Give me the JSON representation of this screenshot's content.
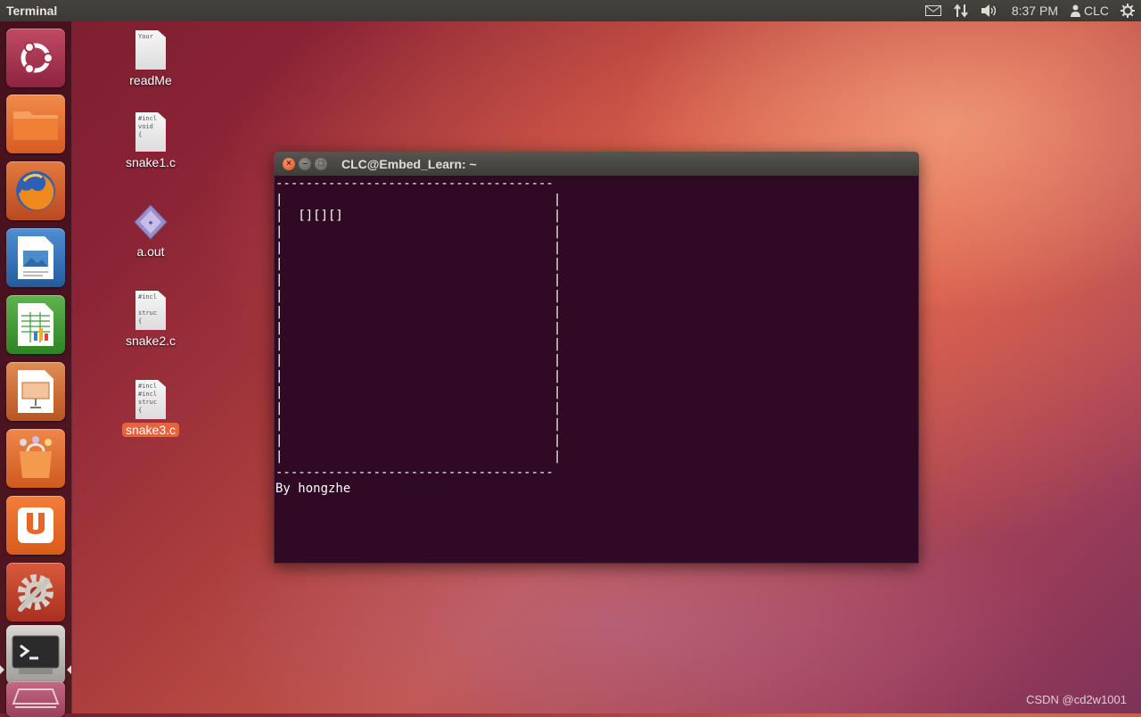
{
  "top_panel": {
    "app_title": "Terminal",
    "clock": "8:37 PM",
    "user": "CLC"
  },
  "launcher": {
    "items": [
      {
        "name": "dash-home",
        "icon": "ubuntu-logo-icon",
        "color": "#b0334d"
      },
      {
        "name": "files",
        "icon": "folder-icon",
        "color": "#e96d31"
      },
      {
        "name": "firefox",
        "icon": "firefox-icon",
        "color": "#d65b2a"
      },
      {
        "name": "libreoffice-writer",
        "icon": "writer-icon",
        "color": "#2f6fb3"
      },
      {
        "name": "libreoffice-calc",
        "icon": "calc-icon",
        "color": "#3b9a37"
      },
      {
        "name": "libreoffice-impress",
        "icon": "impress-icon",
        "color": "#c5692e"
      },
      {
        "name": "software-center",
        "icon": "software-center-icon",
        "color": "#e6702e"
      },
      {
        "name": "ubuntu-one",
        "icon": "ubuntu-one-icon",
        "color": "#e8692a"
      },
      {
        "name": "system-settings",
        "icon": "settings-icon",
        "color": "#c0432d"
      },
      {
        "name": "terminal",
        "icon": "terminal-icon",
        "color": "#b7b6b0"
      },
      {
        "name": "workspace-switcher",
        "icon": "workspace-icon",
        "color": "#b34b66"
      }
    ]
  },
  "desktop": {
    "icons": [
      {
        "label": "readMe",
        "preview": "Your",
        "type": "text"
      },
      {
        "label": "snake1.c",
        "preview": "#incl\nvoid\n{",
        "type": "text"
      },
      {
        "label": "a.out",
        "preview": "",
        "type": "executable"
      },
      {
        "label": "snake2.c",
        "preview": "#incl\n\nstruc\n{",
        "type": "text"
      },
      {
        "label": "snake3.c",
        "preview": "#incl\n#incl\nstruc\n{",
        "type": "text",
        "selected": true
      }
    ]
  },
  "terminal": {
    "title": "CLC@Embed_Learn: ~",
    "screen": "-------------------------------------\n|                                    |\n|  [][][]                            |\n|                                    |\n|                                    |\n|                                    |\n|                                    |\n|                                    |\n|                                    |\n|                                    |\n|                                    |\n|                                    |\n|                                    |\n|                                    |\n|                                    |\n|                                    |\n|                                    |\n|                                    |\n-------------------------------------\nBy hongzhe"
  },
  "watermark": "CSDN @cd2w1001"
}
